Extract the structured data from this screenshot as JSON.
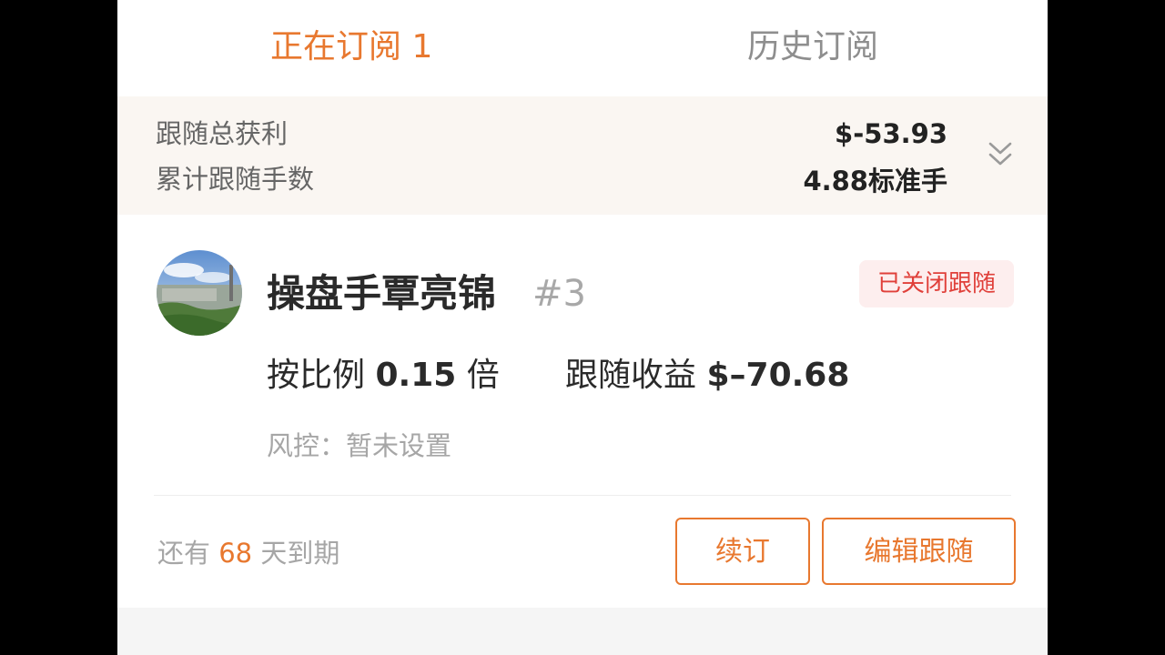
{
  "tabs": {
    "active_label": "正在订阅 1",
    "history_label": "历史订阅"
  },
  "summary": {
    "total_profit_label": "跟随总获利",
    "total_profit_value": "$-53.93",
    "total_lots_label": "累计跟随手数",
    "total_lots_value": "4.88标准手",
    "expand_icon": "double-chevron-down-icon"
  },
  "card": {
    "trader_name": "操盘手覃亮锦",
    "trader_rank": "#3",
    "status_badge": "已关闭跟随",
    "ratio_prefix": "按比例",
    "ratio_value": "0.15",
    "ratio_suffix": "倍",
    "earnings_label": "跟随收益",
    "earnings_value": "$–70.68",
    "risk_text": "风控：暂未设置",
    "expiry_prefix": "还有",
    "expiry_days": "68",
    "expiry_suffix": "天到期",
    "renew_label": "续订",
    "edit_label": "编辑跟随"
  },
  "colors": {
    "accent": "#e8782f",
    "status_red": "#e0403a",
    "status_bg": "#fdeeee",
    "summary_bg": "#faf6f2"
  }
}
